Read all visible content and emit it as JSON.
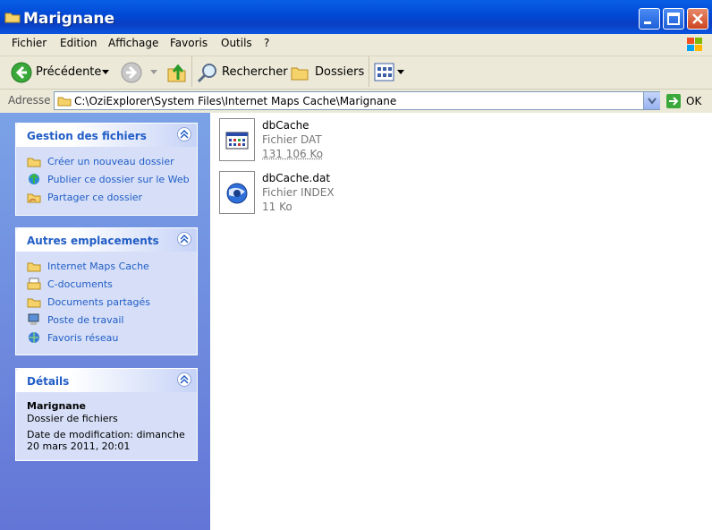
{
  "window": {
    "title": "Marignane"
  },
  "menu": [
    "Fichier",
    "Edition",
    "Affichage",
    "Favoris",
    "Outils",
    "?"
  ],
  "toolbar": {
    "back": "Précédente",
    "search": "Rechercher",
    "folders": "Dossiers"
  },
  "address": {
    "label": "Adresse",
    "path": "C:\\OziExplorer\\System Files\\Internet Maps Cache\\Marignane",
    "go": "OK"
  },
  "panels": {
    "file_tasks": {
      "title": "Gestion des fichiers",
      "items": [
        "Créer un nouveau dossier",
        "Publier ce dossier sur le Web",
        "Partager ce dossier"
      ]
    },
    "other_places": {
      "title": "Autres emplacements",
      "items": [
        "Internet Maps Cache",
        "C-documents",
        "Documents partagés",
        "Poste de travail",
        "Favoris réseau"
      ]
    },
    "details": {
      "title": "Détails",
      "name": "Marignane",
      "type": "Dossier de fichiers",
      "modified": "Date de modification: dimanche 20 mars 2011, 20:01"
    }
  },
  "files": [
    {
      "name": "dbCache",
      "type": "Fichier DAT",
      "size": "131 106 Ko"
    },
    {
      "name": "dbCache.dat",
      "type": "Fichier INDEX",
      "size": "11 Ko"
    }
  ],
  "colors": {
    "titlebar": "#0a54e0",
    "panel_title": "#215dc6",
    "task_link": "#215dc6",
    "pane_bg": "#6f8de0"
  }
}
